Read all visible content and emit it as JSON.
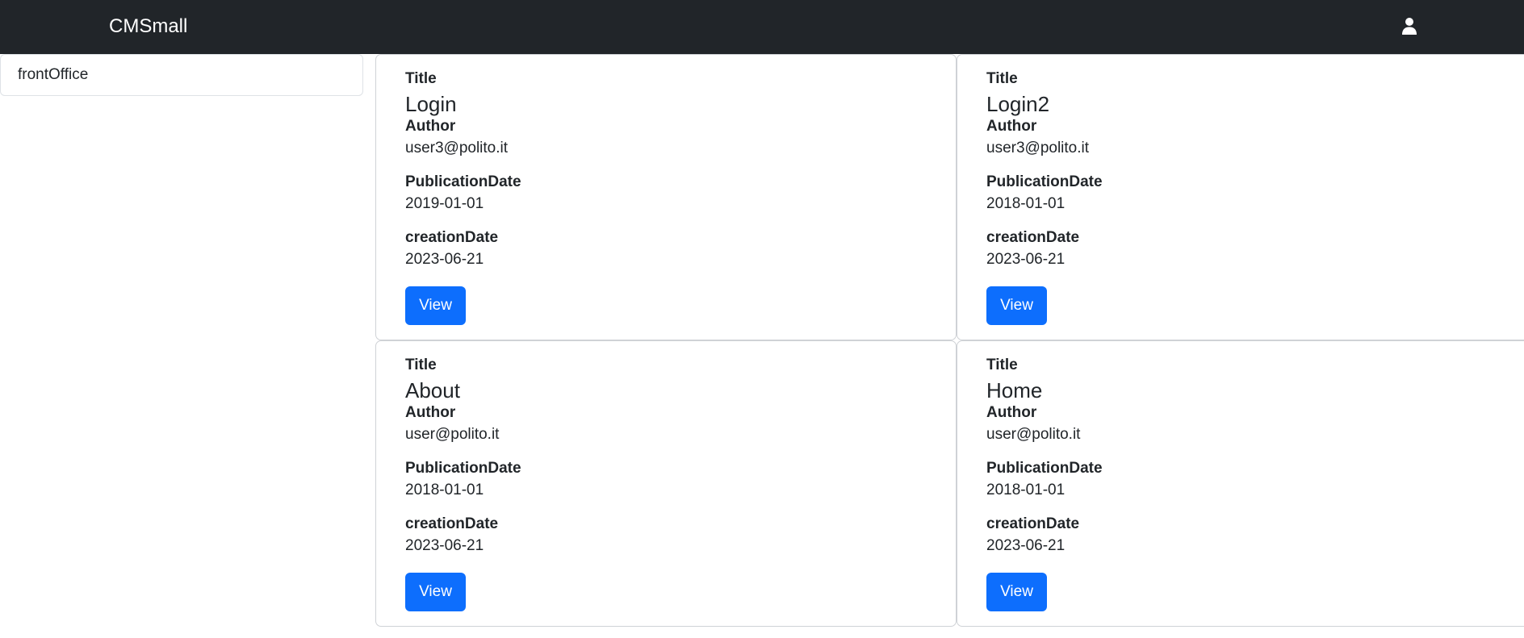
{
  "navbar": {
    "brand": "CMSmall",
    "user_icon": "user-icon"
  },
  "sidebar": {
    "items": [
      {
        "label": "frontOffice"
      }
    ]
  },
  "labels": {
    "title": "Title",
    "author": "Author",
    "publication_date": "PublicationDate",
    "creation_date": "creationDate",
    "view_button": "View"
  },
  "pages": [
    {
      "title": "Login",
      "author": "user3@polito.it",
      "publication_date": "2019-01-01",
      "creation_date": "2023-06-21"
    },
    {
      "title": "Login2",
      "author": "user3@polito.it",
      "publication_date": "2018-01-01",
      "creation_date": "2023-06-21"
    },
    {
      "title": "About",
      "author": "user@polito.it",
      "publication_date": "2018-01-01",
      "creation_date": "2023-06-21"
    },
    {
      "title": "Home",
      "author": "user@polito.it",
      "publication_date": "2018-01-01",
      "creation_date": "2023-06-21"
    }
  ],
  "colors": {
    "navbar_bg": "#212529",
    "button_bg": "#0d6efd",
    "text": "#212529"
  }
}
